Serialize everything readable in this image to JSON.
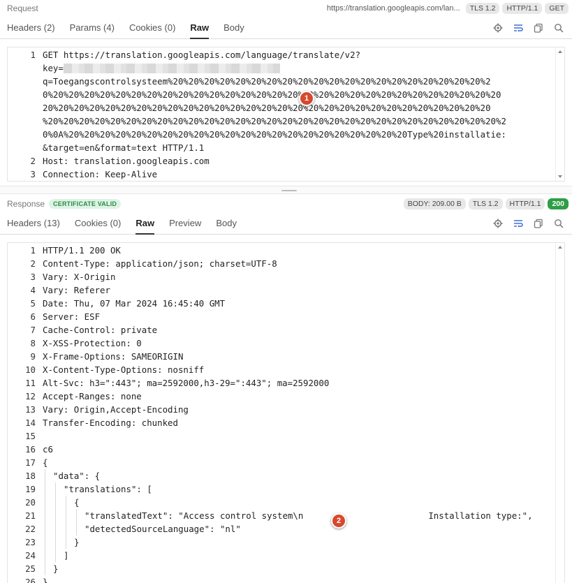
{
  "request": {
    "title": "Request",
    "url": "https://translation.googleapis.com/lan...",
    "tls": "TLS 1.2",
    "http": "HTTP/1.1",
    "method": "GET",
    "tabs": [
      "Headers (2)",
      "Params (4)",
      "Cookies (0)",
      "Raw",
      "Body"
    ],
    "active_tab": "Raw",
    "lines": [
      {
        "n": "1",
        "t": "GET https://translation.googleapis.com/language/translate/v2?"
      },
      {
        "n": "",
        "t": "key="
      },
      {
        "n": "",
        "t": "q=Toegangscontrolsysteem%20%20%20%20%20%20%20%20%20%20%20%20%20%20%20%20%20%20%20%20%2"
      },
      {
        "n": "",
        "t": "0%20%20%20%20%20%20%20%20%20%20%20%20%20%20%20%20%20%20%20%20%20%20%20%20%20%20%20%20%20"
      },
      {
        "n": "",
        "t": "20%20%20%20%20%20%20%20%20%20%20%20%20%20%20%20%20%20%20%20%20%20%20%20%20%20%20%20%20"
      },
      {
        "n": "",
        "t": "%20%20%20%20%20%20%20%20%20%20%20%20%20%20%20%20%20%20%20%20%20%20%20%20%20%20%20%20%20%2"
      },
      {
        "n": "",
        "t": "0%0A%20%20%20%20%20%20%20%20%20%20%20%20%20%20%20%20%20%20%20%20%20%20Type%20installatie:"
      },
      {
        "n": "",
        "t": "&target=en&format=text HTTP/1.1"
      },
      {
        "n": "2",
        "t": "Host: translation.googleapis.com"
      },
      {
        "n": "3",
        "t": "Connection: Keep-Alive"
      }
    ]
  },
  "response": {
    "title": "Response",
    "certificate": "CERTIFICATE VALID",
    "body_size": "BODY: 209.00 B",
    "tls": "TLS 1.2",
    "http": "HTTP/1.1",
    "status": "200",
    "tabs": [
      "Headers (13)",
      "Cookies (0)",
      "Raw",
      "Preview",
      "Body"
    ],
    "active_tab": "Raw",
    "lines": [
      {
        "n": "1",
        "t": "HTTP/1.1 200 OK"
      },
      {
        "n": "2",
        "t": "Content-Type: application/json; charset=UTF-8"
      },
      {
        "n": "3",
        "t": "Vary: X-Origin"
      },
      {
        "n": "4",
        "t": "Vary: Referer"
      },
      {
        "n": "5",
        "t": "Date: Thu, 07 Mar 2024 16:45:40 GMT"
      },
      {
        "n": "6",
        "t": "Server: ESF"
      },
      {
        "n": "7",
        "t": "Cache-Control: private"
      },
      {
        "n": "8",
        "t": "X-XSS-Protection: 0"
      },
      {
        "n": "9",
        "t": "X-Frame-Options: SAMEORIGIN"
      },
      {
        "n": "10",
        "t": "X-Content-Type-Options: nosniff"
      },
      {
        "n": "11",
        "t": "Alt-Svc: h3=\":443\"; ma=2592000,h3-29=\":443\"; ma=2592000"
      },
      {
        "n": "12",
        "t": "Accept-Ranges: none"
      },
      {
        "n": "13",
        "t": "Vary: Origin,Accept-Encoding"
      },
      {
        "n": "14",
        "t": "Transfer-Encoding: chunked"
      },
      {
        "n": "15",
        "t": ""
      },
      {
        "n": "16",
        "t": "c6"
      },
      {
        "n": "17",
        "t": "{"
      },
      {
        "n": "18",
        "t": "\"data\": {",
        "indent": 1
      },
      {
        "n": "19",
        "t": "\"translations\": [",
        "indent": 2
      },
      {
        "n": "20",
        "t": "{",
        "indent": 3
      },
      {
        "n": "21",
        "t": "\"translatedText\": \"Access control system\\n                        Installation type:\",",
        "indent": 4
      },
      {
        "n": "22",
        "t": "\"detectedSourceLanguage\": \"nl\"",
        "indent": 4
      },
      {
        "n": "23",
        "t": "}",
        "indent": 3
      },
      {
        "n": "24",
        "t": "]",
        "indent": 2
      },
      {
        "n": "25",
        "t": "}",
        "indent": 1
      },
      {
        "n": "26",
        "t": "}"
      }
    ]
  },
  "markers": [
    "1",
    "2"
  ]
}
